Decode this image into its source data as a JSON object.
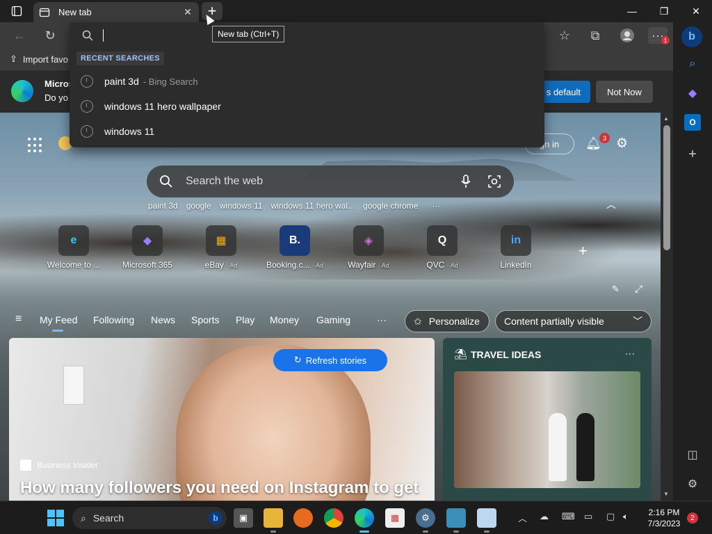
{
  "tab": {
    "title": "New tab",
    "new_tab_tooltip": "New tab (Ctrl+T)"
  },
  "favorites": {
    "import_label": "Import favo"
  },
  "banner": {
    "title": "Micros",
    "text": "Do yo",
    "set_default_label": "s default",
    "not_now_label": "Not Now"
  },
  "omnibox": {
    "value": "",
    "recent_header": "RECENT SEARCHES",
    "recent": [
      {
        "query": "paint 3d",
        "suffix": "- Bing Search"
      },
      {
        "query": "windows 11 hero wallpaper",
        "suffix": ""
      },
      {
        "query": "windows 11",
        "suffix": ""
      }
    ]
  },
  "ntp": {
    "signin_label": "gn in",
    "notifications_count": "3",
    "search_placeholder": "Search the web",
    "suggestions": [
      "paint 3d",
      "google",
      "windows 11",
      "windows 11 hero wal...",
      "google chrome",
      "···"
    ],
    "quick_links": [
      {
        "label": "Welcome to ...",
        "ad": "",
        "glyph": "e",
        "color": "#0a7cd6"
      },
      {
        "label": "Microsoft 365",
        "ad": "",
        "glyph": "◆",
        "color": "#7b61ff"
      },
      {
        "label": "eBay",
        "ad": "· Ad",
        "glyph": "▦",
        "color": "#e53238"
      },
      {
        "label": "Booking.c...",
        "ad": "· Ad",
        "glyph": "B.",
        "color": "#003580"
      },
      {
        "label": "Wayfair",
        "ad": "· Ad",
        "glyph": "◈",
        "color": "#7f187f"
      },
      {
        "label": "QVC",
        "ad": "· Ad",
        "glyph": "Q",
        "color": "#ffffff"
      },
      {
        "label": "LinkedIn",
        "ad": "",
        "glyph": "in",
        "color": "#0a66c2"
      }
    ],
    "feed_tabs": [
      "My Feed",
      "Following",
      "News",
      "Sports",
      "Play",
      "Money",
      "Gaming",
      "···"
    ],
    "personalize_label": "Personalize",
    "content_visibility": "Content partially visible"
  },
  "main_card": {
    "refresh_label": "Refresh stories",
    "source": "Business Insider",
    "headline": "How many followers you need on Instagram to get"
  },
  "travel_card": {
    "title": "TRAVEL IDEAS"
  },
  "taskbar": {
    "search_label": "Search",
    "time": "2:16 PM",
    "date": "7/3/2023",
    "notification_count": "2"
  },
  "colors": {
    "accent": "#0f6cbd",
    "feed_active": "#8ab4f8",
    "badge": "#d13438"
  }
}
